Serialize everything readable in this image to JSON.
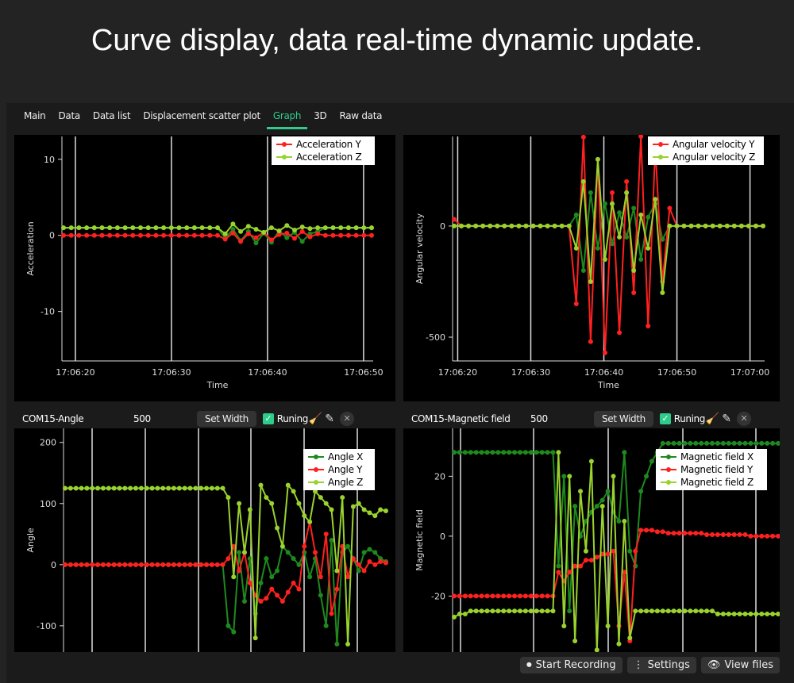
{
  "headline": "Curve display, data real-time dynamic update.",
  "tabs": [
    {
      "label": "Main"
    },
    {
      "label": "Data"
    },
    {
      "label": "Data list"
    },
    {
      "label": "Displacement scatter plot"
    },
    {
      "label": "Graph",
      "active": true
    },
    {
      "label": "3D"
    },
    {
      "label": "Raw data"
    }
  ],
  "colors": {
    "accent": "#2ecc8a",
    "x_series": "#1e8a1e",
    "y_series": "#ff2020",
    "z_series": "#9ad22e"
  },
  "panels": {
    "angle": {
      "title": "COM15-Angle",
      "count": "500",
      "set_width": "Set Width",
      "running": "Runing"
    },
    "magnetic": {
      "title": "COM15-Magnetic field",
      "count": "500",
      "set_width": "Set Width",
      "running": "Runing"
    }
  },
  "footer": {
    "start_recording": "Start Recording",
    "settings": "Settings",
    "view_files": "View files"
  },
  "chart_data": [
    {
      "id": "acc",
      "type": "line",
      "xlabel": "Time",
      "ylabel": "Acceleration",
      "xlim": [
        "17:06:18.6",
        "17:06:51"
      ],
      "xticks": [
        "17:06:20",
        "17:06:30",
        "17:06:40",
        "17:06:50"
      ],
      "ylim": [
        -16.5,
        13
      ],
      "yticks": [
        10,
        0,
        -10
      ],
      "series": [
        {
          "color": "#1e8a1e",
          "values": [
            1,
            1,
            1,
            1,
            1,
            1,
            1,
            1,
            1,
            1,
            1,
            1,
            1,
            1,
            1,
            1,
            1,
            1,
            1,
            1,
            1,
            -0.4,
            0.8,
            -0.7,
            0.5,
            -1,
            0.3,
            -0.9,
            0.6,
            -0.3,
            0.4,
            -0.8,
            0.2,
            0.5,
            1,
            1,
            1,
            1,
            1,
            1,
            1
          ]
        },
        {
          "name": "Acceleration Y",
          "color": "#ff2020",
          "values": [
            0,
            0,
            0,
            0,
            0,
            0,
            0,
            0,
            0,
            0,
            0,
            0,
            0,
            0,
            0,
            0,
            0,
            0,
            0,
            0,
            0,
            -0.5,
            0.3,
            -0.8,
            0.2,
            -0.3,
            0.4,
            -0.6,
            0.1,
            0.3,
            -0.4,
            0.5,
            -0.2,
            0.2,
            0,
            0,
            0,
            0,
            0,
            0,
            0
          ]
        },
        {
          "name": "Acceleration Z",
          "color": "#9ad22e",
          "values": [
            1,
            1,
            1,
            1,
            1,
            1,
            1,
            1,
            1,
            1,
            1,
            1,
            1,
            1,
            1,
            1,
            1,
            1,
            1,
            1,
            1,
            0.2,
            1.5,
            0.5,
            1.2,
            0.8,
            0.4,
            1.0,
            0.6,
            1.3,
            0.7,
            1.1,
            0.9,
            1.0,
            1,
            1,
            1,
            1,
            1,
            1,
            1
          ]
        }
      ]
    },
    {
      "id": "gyro",
      "type": "line",
      "xlabel": "Time",
      "ylabel": "Angular velocity",
      "xlim": [
        "17:06:19.3",
        "17:07:02"
      ],
      "xticks": [
        "17:06:20",
        "17:06:30",
        "17:06:40",
        "17:06:50",
        "17:07:00"
      ],
      "ylim": [
        -607,
        403
      ],
      "yticks": [
        0,
        -500
      ],
      "series": [
        {
          "color": "#1e8a1e",
          "values": [
            0,
            0,
            0,
            0,
            0,
            0,
            0,
            0,
            0,
            0,
            0,
            0,
            0,
            0,
            0,
            0,
            0,
            50,
            -200,
            150,
            -100,
            100,
            -80,
            60,
            -50,
            80,
            -150,
            40,
            100,
            -60,
            0,
            0,
            0,
            0,
            0,
            0,
            0,
            0,
            0,
            0,
            0,
            0,
            0,
            0
          ]
        },
        {
          "name": "Angular velocity Y",
          "color": "#ff2020",
          "values": [
            30,
            0,
            0,
            0,
            0,
            0,
            0,
            0,
            0,
            0,
            0,
            0,
            0,
            0,
            0,
            0,
            0,
            -350,
            400,
            -520,
            300,
            -570,
            150,
            -480,
            200,
            -300,
            420,
            -450,
            350,
            -250,
            80,
            0,
            0,
            0,
            0,
            0,
            0,
            0,
            0,
            0,
            0,
            0,
            0,
            0
          ]
        },
        {
          "name": "Angular velocity Z",
          "color": "#9ad22e",
          "values": [
            0,
            0,
            0,
            0,
            0,
            0,
            0,
            0,
            0,
            0,
            0,
            0,
            0,
            0,
            0,
            0,
            0,
            -100,
            200,
            -250,
            300,
            -150,
            100,
            -50,
            150,
            -200,
            50,
            -100,
            120,
            -300,
            0,
            0,
            0,
            0,
            0,
            0,
            0,
            0,
            0,
            0,
            0,
            0,
            0,
            0
          ]
        }
      ]
    },
    {
      "id": "angle",
      "type": "line",
      "xlabel": "",
      "ylabel": "Angle",
      "ylim": [
        -143,
        223
      ],
      "yticks": [
        200,
        100,
        0,
        -100
      ],
      "series": [
        {
          "name": "Angle X",
          "color": "#1e8a1e",
          "values": [
            0,
            0,
            0,
            0,
            0,
            0,
            0,
            0,
            0,
            0,
            0,
            0,
            0,
            0,
            0,
            0,
            0,
            0,
            0,
            0,
            0,
            0,
            0,
            0,
            0,
            0,
            0,
            0,
            0,
            0,
            -100,
            -110,
            20,
            -60,
            10,
            -80,
            -30,
            10,
            -20,
            -10,
            30,
            20,
            10,
            0,
            20,
            -20,
            10,
            -50,
            -100,
            40,
            -130,
            20,
            30,
            10,
            -10,
            20,
            25,
            20,
            10,
            5
          ]
        },
        {
          "name": "Angle Y",
          "color": "#ff2020",
          "values": [
            0,
            0,
            0,
            0,
            0,
            0,
            0,
            0,
            0,
            0,
            0,
            0,
            0,
            0,
            0,
            0,
            0,
            0,
            0,
            0,
            0,
            0,
            0,
            0,
            0,
            0,
            0,
            0,
            0,
            0,
            10,
            30,
            -10,
            20,
            -30,
            -50,
            -60,
            -55,
            -40,
            -50,
            -60,
            -45,
            -30,
            -40,
            30,
            70,
            20,
            -20,
            50,
            -80,
            -40,
            30,
            -20,
            10,
            0,
            -10,
            5,
            0,
            5,
            3
          ]
        },
        {
          "name": "Angle Z",
          "color": "#9ad22e",
          "values": [
            125,
            125,
            125,
            125,
            125,
            125,
            125,
            125,
            125,
            125,
            125,
            125,
            125,
            125,
            125,
            125,
            125,
            125,
            125,
            125,
            125,
            125,
            125,
            125,
            125,
            125,
            125,
            125,
            125,
            125,
            110,
            -20,
            100,
            20,
            90,
            -120,
            130,
            110,
            100,
            60,
            30,
            130,
            120,
            100,
            80,
            70,
            120,
            110,
            100,
            90,
            -10,
            110,
            -130,
            95,
            100,
            90,
            85,
            80,
            90,
            88
          ]
        }
      ]
    },
    {
      "id": "magnetic",
      "type": "line",
      "xlabel": "",
      "ylabel": "Magnetic field",
      "ylim": [
        -38.7,
        36
      ],
      "yticks": [
        20,
        0,
        -20
      ],
      "series": [
        {
          "name": "Magnetic field X",
          "color": "#1e8a1e",
          "values": [
            28,
            28,
            28,
            28,
            28,
            28,
            28,
            28,
            28,
            28,
            28,
            28,
            28,
            28,
            28,
            28,
            28,
            28,
            28,
            -10,
            20,
            -25,
            10,
            0,
            5,
            8,
            10,
            12,
            15,
            8,
            5,
            28,
            -5,
            -10,
            15,
            20,
            25,
            28,
            31,
            31,
            31,
            31,
            31,
            31,
            31,
            31,
            31,
            31,
            31,
            31,
            31,
            31,
            31,
            31,
            31,
            31,
            31,
            31,
            31,
            31
          ]
        },
        {
          "name": "Magnetic field Y",
          "color": "#ff2020",
          "values": [
            -20,
            -20,
            -20,
            -20,
            -20,
            -20,
            -20,
            -20,
            -20,
            -20,
            -20,
            -20,
            -20,
            -20,
            -20,
            -20,
            -20,
            -20,
            -20,
            -12,
            -15,
            -12,
            -10,
            -10,
            -8,
            -8,
            -7,
            -6,
            -6,
            -5,
            -30,
            -12,
            -35,
            -5,
            2,
            2,
            2,
            1.5,
            1.5,
            1,
            1,
            1,
            1,
            1,
            1,
            1,
            0.5,
            0.5,
            0.5,
            0.5,
            0.5,
            0.5,
            0.5,
            0.5,
            0,
            0,
            0,
            0,
            0,
            0
          ]
        },
        {
          "name": "Magnetic field Z",
          "color": "#9ad22e",
          "values": [
            -27,
            -26,
            -26,
            -25,
            -25,
            -25,
            -25,
            -25,
            -25,
            -25,
            -25,
            -25,
            -25,
            -25,
            -25,
            -25,
            -25,
            -25,
            -25,
            28,
            -30,
            20,
            -35,
            15,
            -5,
            25,
            -38,
            10,
            -30,
            20,
            -36,
            5,
            -34,
            -25,
            -25,
            -25,
            -25,
            -25,
            -25,
            -25,
            -25,
            -25,
            -25,
            -25,
            -25,
            -25,
            -25,
            -25,
            -26,
            -26,
            -26,
            -26,
            -26,
            -26,
            -26,
            -26,
            -26,
            -26,
            -26,
            -26
          ]
        }
      ]
    }
  ]
}
